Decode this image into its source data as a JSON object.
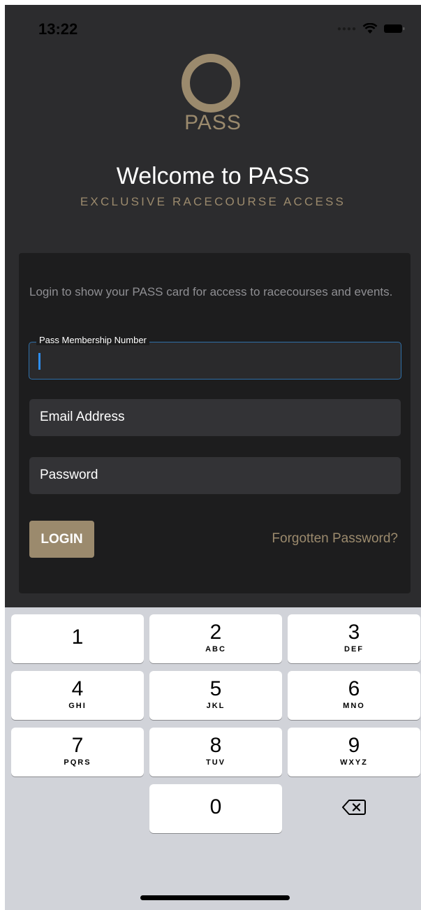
{
  "status_bar": {
    "time": "13:22"
  },
  "logo": {
    "text": "PASS"
  },
  "header": {
    "title": "Welcome to PASS",
    "tagline": "EXCLUSIVE RACECOURSE ACCESS"
  },
  "login_form": {
    "intro": "Login to show your PASS card for access to racecourses and events.",
    "membership_label": "Pass Membership Number",
    "membership_value": "",
    "email_placeholder": "Email Address",
    "password_placeholder": "Password",
    "login_label": "LOGIN",
    "forgot_label": "Forgotten Password?"
  },
  "keypad": {
    "keys": [
      {
        "digit": "1",
        "letters": ""
      },
      {
        "digit": "2",
        "letters": "ABC"
      },
      {
        "digit": "3",
        "letters": "DEF"
      },
      {
        "digit": "4",
        "letters": "GHI"
      },
      {
        "digit": "5",
        "letters": "JKL"
      },
      {
        "digit": "6",
        "letters": "MNO"
      },
      {
        "digit": "7",
        "letters": "PQRS"
      },
      {
        "digit": "8",
        "letters": "TUV"
      },
      {
        "digit": "9",
        "letters": "WXYZ"
      },
      {
        "digit": "0",
        "letters": ""
      }
    ],
    "backspace_icon": "backspace-icon"
  },
  "colors": {
    "accent_gold": "#9b8a6d",
    "background": "#2c2c2e",
    "card": "#1d1d1e",
    "focus_border": "#2f6fa8"
  }
}
